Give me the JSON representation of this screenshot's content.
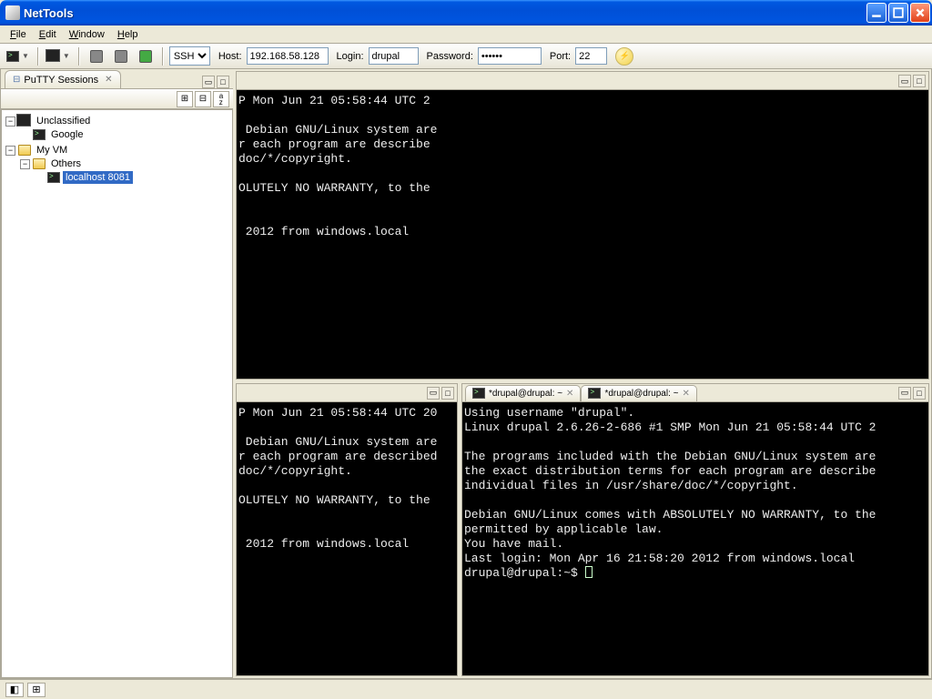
{
  "window": {
    "title": "NetTools"
  },
  "menu": {
    "file": "File",
    "edit": "Edit",
    "window": "Window",
    "help": "Help"
  },
  "toolbar": {
    "protocol_options": [
      "SSH"
    ],
    "protocol_selected": "SSH",
    "host_label": "Host:",
    "host_value": "192.168.58.128",
    "login_label": "Login:",
    "login_value": "drupal",
    "password_label": "Password:",
    "password_value": "••••••",
    "port_label": "Port:",
    "port_value": "22"
  },
  "sidebar": {
    "tab_label": "PuTTY Sessions",
    "sort_btn": "a↓z",
    "tree": {
      "unclassified": "Unclassified",
      "google": "Google",
      "myvm": "My VM",
      "others": "Others",
      "localhost": "localhost 8081"
    }
  },
  "panes": {
    "tab_label": "*drupal@drupal: ~",
    "top_text": "P Mon Jun 21 05:58:44 UTC 2\n\n Debian GNU/Linux system are\nr each program are describe\ndoc/*/copyright.\n\nOLUTELY NO WARRANTY, to the\n\n\n 2012 from windows.local",
    "bl_text": "P Mon Jun 21 05:58:44 UTC 20\n\n Debian GNU/Linux system are\nr each program are described\ndoc/*/copyright.\n\nOLUTELY NO WARRANTY, to the\n\n\n 2012 from windows.local",
    "br_text": "Using username \"drupal\".\nLinux drupal 2.6.26-2-686 #1 SMP Mon Jun 21 05:58:44 UTC 2\n\nThe programs included with the Debian GNU/Linux system are\nthe exact distribution terms for each program are describe\nindividual files in /usr/share/doc/*/copyright.\n\nDebian GNU/Linux comes with ABSOLUTELY NO WARRANTY, to the\npermitted by applicable law.\nYou have mail.\nLast login: Mon Apr 16 21:58:20 2012 from windows.local\ndrupal@drupal:~$ "
  }
}
